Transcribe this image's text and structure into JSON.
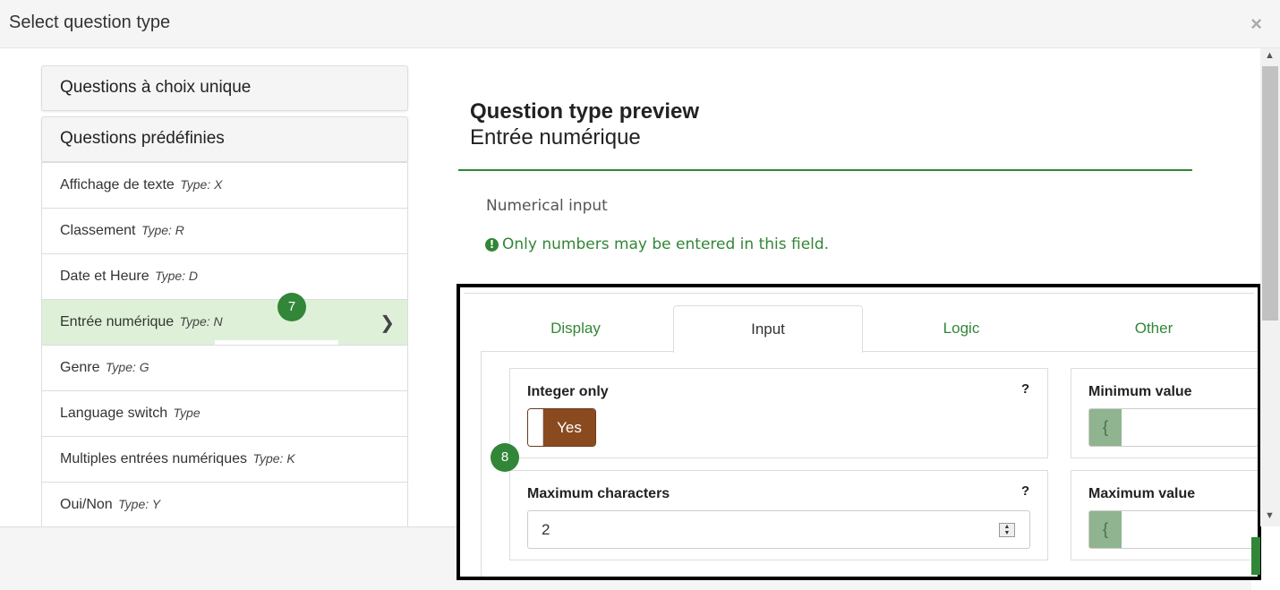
{
  "modal": {
    "title": "Select question type",
    "close": "×"
  },
  "groups": [
    {
      "label": "Questions à choix unique"
    },
    {
      "label": "Questions prédéfinies"
    }
  ],
  "question_types": [
    {
      "name": "Affichage de texte",
      "type": "Type: X"
    },
    {
      "name": "Classement",
      "type": "Type: R"
    },
    {
      "name": "Date et Heure",
      "type": "Type: D"
    },
    {
      "name": "Entrée numérique",
      "type": "Type: N"
    },
    {
      "name": "Genre",
      "type": "Type: G"
    },
    {
      "name": "Language switch",
      "type": "Type"
    },
    {
      "name": "Multiples entrées numériques",
      "type": "Type: K"
    },
    {
      "name": "Oui/Non",
      "type": "Type: Y"
    }
  ],
  "badges": {
    "step7": "7",
    "step8": "8"
  },
  "preview": {
    "heading": "Question type preview",
    "subtitle": "Entrée numérique",
    "question_text": "Numerical input",
    "tip_icon": "!",
    "tip_text": "Only numbers may be entered in this field."
  },
  "tabs": [
    "Display",
    "Input",
    "Logic",
    "Other"
  ],
  "settings": {
    "integer_only": {
      "label": "Integer only",
      "help": "?",
      "value": "Yes"
    },
    "max_chars": {
      "label": "Maximum characters",
      "help": "?",
      "value": "2"
    },
    "min_value": {
      "label": "Minimum value",
      "addon": "{"
    },
    "max_value": {
      "label": "Maximum value",
      "addon": "{"
    }
  },
  "colors": {
    "accent": "#328637",
    "toggle": "#8a4a1f",
    "active_row": "#dff0d8"
  }
}
